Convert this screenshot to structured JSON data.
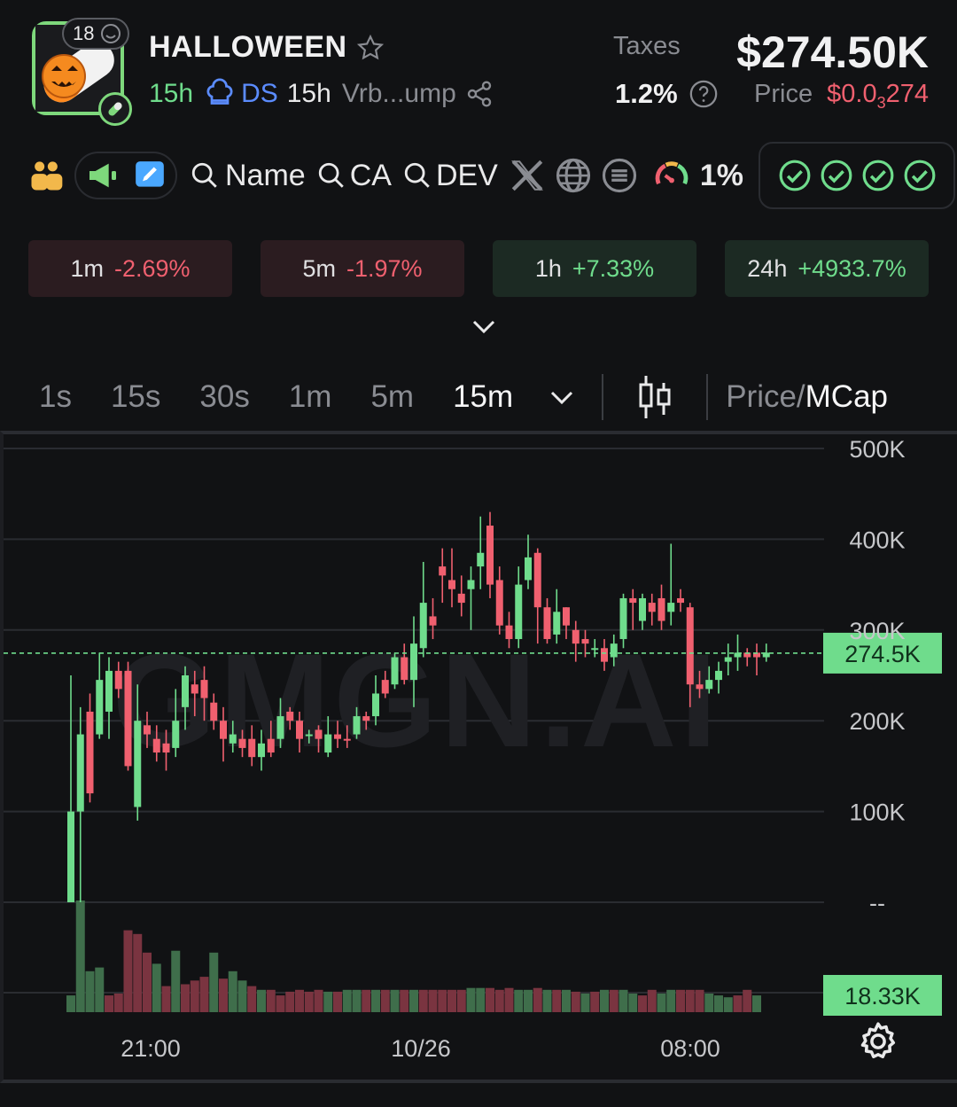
{
  "header": {
    "age_badge": "18",
    "token_name": "HALLOWEEN",
    "age": "15h",
    "ds_label": "DS",
    "ds_age": "15h",
    "short_address": "Vrb...ump",
    "taxes_label": "Taxes",
    "taxes_value": "1.2%",
    "market_cap": "$274.50K",
    "price_label": "Price",
    "price_prefix": "$0.0",
    "price_subscript": "3",
    "price_suffix": "274"
  },
  "toolbar": {
    "search_name": "Name",
    "search_ca": "CA",
    "search_dev": "DEV",
    "gauge_value": "1%"
  },
  "changes": [
    {
      "period": "1m",
      "value": "-2.69%",
      "trend": "down"
    },
    {
      "period": "5m",
      "value": "-1.97%",
      "trend": "down"
    },
    {
      "period": "1h",
      "value": "+7.33%",
      "trend": "up"
    },
    {
      "period": "24h",
      "value": "+4933.7%",
      "trend": "up"
    }
  ],
  "intervals": [
    "1s",
    "15s",
    "30s",
    "1m",
    "5m",
    "15m"
  ],
  "active_interval": "15m",
  "price_toggle": {
    "left": "Price/",
    "right": "MCap"
  },
  "colors": {
    "up": "#6fdc8c",
    "down": "#f0606f",
    "bg": "#111214"
  },
  "chart_data": {
    "type": "candlestick",
    "watermark": "GMGN.AI",
    "y_ticks": [
      "500K",
      "400K",
      "300K",
      "200K",
      "100K",
      "--"
    ],
    "x_ticks": [
      "21:00",
      "10/26",
      "08:00"
    ],
    "ylim": [
      0,
      500000
    ],
    "current_price_label": "274.5K",
    "current_volume_label": "18.33K",
    "current_value": 274500,
    "candles": [
      [
        0,
        100000,
        100000,
        250000,
        0
      ],
      [
        100000,
        185000,
        0,
        215000,
        0
      ],
      [
        120000,
        210000,
        110000,
        230000,
        1
      ],
      [
        185000,
        245000,
        180000,
        275000,
        0
      ],
      [
        210000,
        255000,
        180000,
        270000,
        0
      ],
      [
        255000,
        235000,
        225000,
        265000,
        1
      ],
      [
        255000,
        150000,
        145000,
        265000,
        1
      ],
      [
        105000,
        200000,
        90000,
        240000,
        0
      ],
      [
        195000,
        185000,
        170000,
        210000,
        1
      ],
      [
        180000,
        165000,
        155000,
        195000,
        1
      ],
      [
        175000,
        165000,
        145000,
        190000,
        1
      ],
      [
        170000,
        200000,
        160000,
        235000,
        0
      ],
      [
        215000,
        250000,
        190000,
        260000,
        0
      ],
      [
        240000,
        230000,
        205000,
        255000,
        1
      ],
      [
        245000,
        225000,
        200000,
        260000,
        1
      ],
      [
        220000,
        200000,
        190000,
        230000,
        1
      ],
      [
        200000,
        180000,
        155000,
        215000,
        1
      ],
      [
        175000,
        185000,
        165000,
        200000,
        0
      ],
      [
        170000,
        180000,
        160000,
        190000,
        1
      ],
      [
        180000,
        160000,
        150000,
        195000,
        1
      ],
      [
        160000,
        175000,
        145000,
        190000,
        0
      ],
      [
        165000,
        180000,
        160000,
        200000,
        1
      ],
      [
        180000,
        205000,
        170000,
        225000,
        0
      ],
      [
        210000,
        200000,
        190000,
        215000,
        1
      ],
      [
        200000,
        180000,
        165000,
        210000,
        1
      ],
      [
        185000,
        185000,
        175000,
        190000,
        0
      ],
      [
        190000,
        180000,
        165000,
        195000,
        1
      ],
      [
        165000,
        185000,
        160000,
        205000,
        0
      ],
      [
        180000,
        185000,
        170000,
        200000,
        1
      ],
      [
        180000,
        180000,
        170000,
        195000,
        1
      ],
      [
        185000,
        205000,
        180000,
        215000,
        0
      ],
      [
        200000,
        205000,
        190000,
        210000,
        1
      ],
      [
        205000,
        230000,
        195000,
        250000,
        0
      ],
      [
        245000,
        230000,
        225000,
        255000,
        1
      ],
      [
        240000,
        270000,
        235000,
        275000,
        0
      ],
      [
        270000,
        245000,
        240000,
        285000,
        1
      ],
      [
        245000,
        285000,
        215000,
        315000,
        0
      ],
      [
        280000,
        330000,
        270000,
        375000,
        0
      ],
      [
        315000,
        305000,
        290000,
        335000,
        1
      ],
      [
        370000,
        360000,
        330000,
        390000,
        1
      ],
      [
        355000,
        345000,
        325000,
        390000,
        1
      ],
      [
        340000,
        330000,
        315000,
        360000,
        1
      ],
      [
        345000,
        355000,
        300000,
        370000,
        0
      ],
      [
        370000,
        385000,
        345000,
        425000,
        0
      ],
      [
        415000,
        350000,
        335000,
        430000,
        1
      ],
      [
        355000,
        305000,
        295000,
        370000,
        1
      ],
      [
        305000,
        290000,
        280000,
        320000,
        1
      ],
      [
        290000,
        350000,
        280000,
        370000,
        0
      ],
      [
        355000,
        380000,
        345000,
        405000,
        0
      ],
      [
        385000,
        325000,
        285000,
        390000,
        1
      ],
      [
        325000,
        290000,
        285000,
        335000,
        1
      ],
      [
        295000,
        320000,
        285000,
        345000,
        0
      ],
      [
        325000,
        305000,
        290000,
        325000,
        1
      ],
      [
        300000,
        285000,
        265000,
        310000,
        1
      ],
      [
        290000,
        285000,
        270000,
        300000,
        1
      ],
      [
        280000,
        280000,
        270000,
        290000,
        0
      ],
      [
        280000,
        265000,
        255000,
        290000,
        1
      ],
      [
        270000,
        285000,
        260000,
        295000,
        0
      ],
      [
        290000,
        335000,
        280000,
        340000,
        0
      ],
      [
        330000,
        335000,
        300000,
        345000,
        1
      ],
      [
        310000,
        335000,
        300000,
        340000,
        0
      ],
      [
        330000,
        320000,
        305000,
        340000,
        1
      ],
      [
        335000,
        310000,
        300000,
        350000,
        1
      ],
      [
        320000,
        330000,
        305000,
        395000,
        0
      ],
      [
        330000,
        335000,
        320000,
        345000,
        1
      ],
      [
        325000,
        240000,
        215000,
        330000,
        1
      ],
      [
        240000,
        235000,
        225000,
        255000,
        1
      ],
      [
        235000,
        245000,
        230000,
        260000,
        0
      ],
      [
        245000,
        255000,
        230000,
        265000,
        0
      ],
      [
        265000,
        270000,
        250000,
        285000,
        0
      ],
      [
        270000,
        275000,
        255000,
        295000,
        0
      ],
      [
        275000,
        270000,
        260000,
        280000,
        1
      ],
      [
        275000,
        270000,
        250000,
        285000,
        1
      ],
      [
        270000,
        275000,
        265000,
        285000,
        0
      ]
    ],
    "volumes": [
      [
        0.45,
        0
      ],
      [
        3.0,
        0
      ],
      [
        1.1,
        0
      ],
      [
        1.2,
        0
      ],
      [
        0.45,
        1
      ],
      [
        0.5,
        1
      ],
      [
        2.2,
        1
      ],
      [
        2.1,
        1
      ],
      [
        1.6,
        1
      ],
      [
        1.3,
        0
      ],
      [
        0.7,
        1
      ],
      [
        1.65,
        0
      ],
      [
        0.75,
        1
      ],
      [
        0.85,
        1
      ],
      [
        0.95,
        1
      ],
      [
        1.6,
        0
      ],
      [
        0.9,
        1
      ],
      [
        1.1,
        0
      ],
      [
        0.85,
        0
      ],
      [
        0.7,
        1
      ],
      [
        0.6,
        0
      ],
      [
        0.6,
        1
      ],
      [
        0.45,
        1
      ],
      [
        0.55,
        1
      ],
      [
        0.6,
        1
      ],
      [
        0.55,
        1
      ],
      [
        0.6,
        1
      ],
      [
        0.55,
        0
      ],
      [
        0.55,
        1
      ],
      [
        0.6,
        0
      ],
      [
        0.6,
        0
      ],
      [
        0.6,
        1
      ],
      [
        0.6,
        0
      ],
      [
        0.6,
        1
      ],
      [
        0.6,
        0
      ],
      [
        0.6,
        1
      ],
      [
        0.6,
        0
      ],
      [
        0.6,
        1
      ],
      [
        0.6,
        1
      ],
      [
        0.6,
        1
      ],
      [
        0.6,
        1
      ],
      [
        0.6,
        1
      ],
      [
        0.65,
        0
      ],
      [
        0.65,
        0
      ],
      [
        0.65,
        1
      ],
      [
        0.6,
        1
      ],
      [
        0.65,
        1
      ],
      [
        0.6,
        0
      ],
      [
        0.6,
        0
      ],
      [
        0.65,
        1
      ],
      [
        0.6,
        0
      ],
      [
        0.6,
        1
      ],
      [
        0.6,
        0
      ],
      [
        0.55,
        1
      ],
      [
        0.5,
        0
      ],
      [
        0.55,
        1
      ],
      [
        0.6,
        0
      ],
      [
        0.6,
        1
      ],
      [
        0.6,
        0
      ],
      [
        0.5,
        0
      ],
      [
        0.45,
        1
      ],
      [
        0.6,
        1
      ],
      [
        0.5,
        0
      ],
      [
        0.6,
        0
      ],
      [
        0.6,
        1
      ],
      [
        0.6,
        1
      ],
      [
        0.6,
        1
      ],
      [
        0.5,
        0
      ],
      [
        0.45,
        0
      ],
      [
        0.4,
        0
      ],
      [
        0.45,
        1
      ],
      [
        0.6,
        1
      ],
      [
        0.45,
        0
      ]
    ]
  }
}
